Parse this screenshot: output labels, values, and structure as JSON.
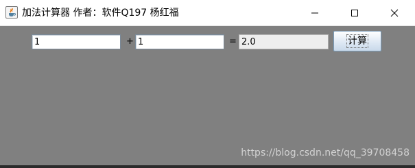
{
  "window": {
    "title": "加法计算器 作者：软件Q197 杨红福",
    "app_icon": "java-cup-icon",
    "controls": [
      "minimize-icon",
      "maximize-icon",
      "close-icon"
    ]
  },
  "calculator": {
    "operand1": "1",
    "plus_sign": "+",
    "operand2": "1",
    "equals_sign": "=",
    "result": "2.0",
    "button_label": "计算"
  },
  "watermark": "https://blog.csdn.net/qq_39708458",
  "colors": {
    "background": "#808080",
    "titlebar": "#ffffff",
    "result_field": "#eeeeee"
  }
}
